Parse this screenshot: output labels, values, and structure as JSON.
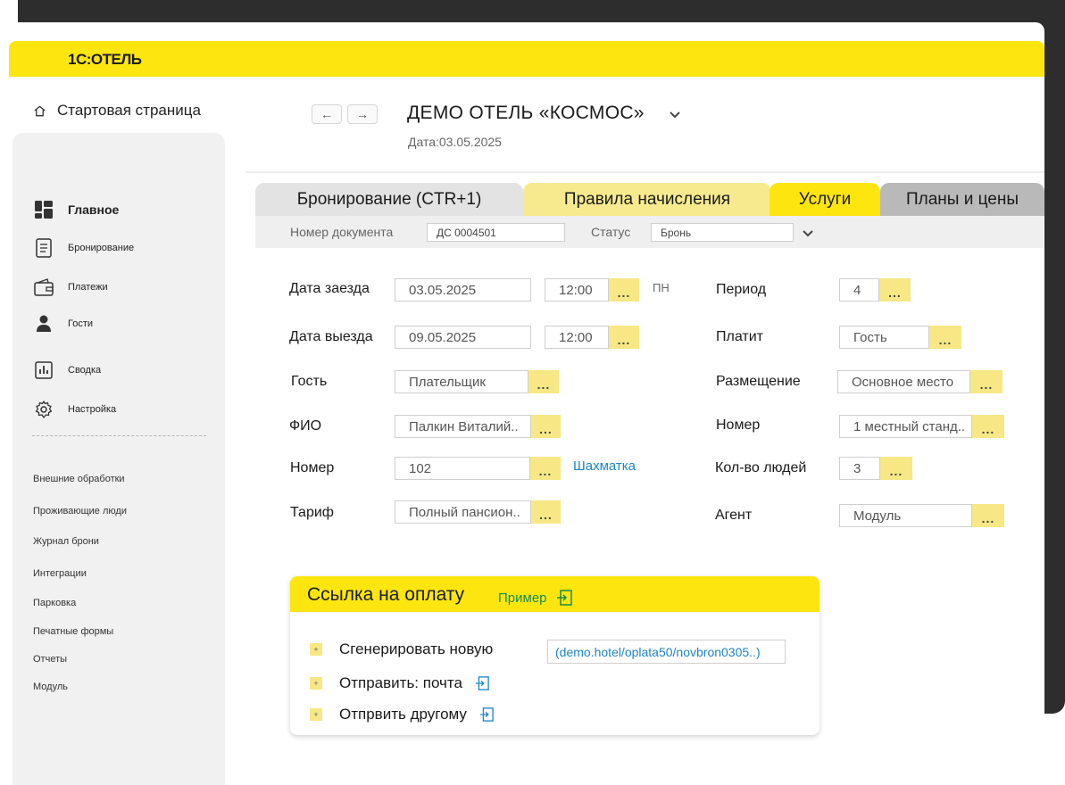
{
  "app": {
    "logo": "1С:ОТЕЛЬ",
    "home_label": "Стартовая страница"
  },
  "header": {
    "back": "←",
    "forward": "→",
    "hotel_name": "ДЕМО ОТЕЛЬ «КОСМОС»",
    "date": "Дата:03.05.2025"
  },
  "sidebar": {
    "main_items": [
      {
        "label": "Главное",
        "icon": "dashboard-icon"
      },
      {
        "label": "Бронирование",
        "icon": "document-list-icon"
      },
      {
        "label": "Платежи",
        "icon": "wallet-icon"
      },
      {
        "label": "Гости",
        "icon": "user-icon"
      },
      {
        "label": "Сводка",
        "icon": "bar-chart-icon"
      },
      {
        "label": "Настройка",
        "icon": "gear-icon"
      }
    ],
    "sub_items": [
      "Внешние обработки",
      "Проживающие люди",
      "Журнал брони",
      "Интеграции",
      "Парковка",
      "Печатные формы",
      "Отчеты",
      "Модуль"
    ]
  },
  "tabs": [
    "Бронирование (CTR+1)",
    "Правила начисления",
    "Услуги",
    "Планы и цены"
  ],
  "docbar": {
    "doc_label": "Номер документа",
    "doc_value": "ДС 0004501",
    "status_label": "Статус",
    "status_value": "Бронь"
  },
  "form": {
    "checkin_label": "Дата заезда",
    "checkin_date": "03.05.2025",
    "checkin_time": "12:00",
    "weekday": "ПН",
    "checkout_label": "Дата выезда",
    "checkout_date": "09.05.2025",
    "checkout_time": "12:00",
    "guest_label": "Гость",
    "guest_value": "Плательщик",
    "fio_label": "ФИО",
    "fio_value": "Палкин Виталий..",
    "room_label": "Номер",
    "room_value": "102",
    "chess_link": "Шахматка",
    "tariff_label": "Тариф",
    "tariff_value": "Полный пансион..",
    "period_label": "Период",
    "period_value": "4",
    "payer_label": "Платит",
    "payer_value": "Гость",
    "placement_label": "Размещение",
    "placement_value": "Основное место",
    "room_type_label": "Номер",
    "room_type_value": "1 местный станд..",
    "people_label": "Кол-во людей",
    "people_value": "3",
    "agent_label": "Агент",
    "agent_value": "Модуль",
    "dots": "..."
  },
  "payment": {
    "title": "Ссылка на оплату",
    "example": "Пример",
    "generate": "Сгенерировать новую",
    "send_mail": "Отправить: почта",
    "send_other": "Отпрвить другому",
    "url": "(demo.hotel/oplata50/novbron0305..)",
    "plus": "+"
  }
}
